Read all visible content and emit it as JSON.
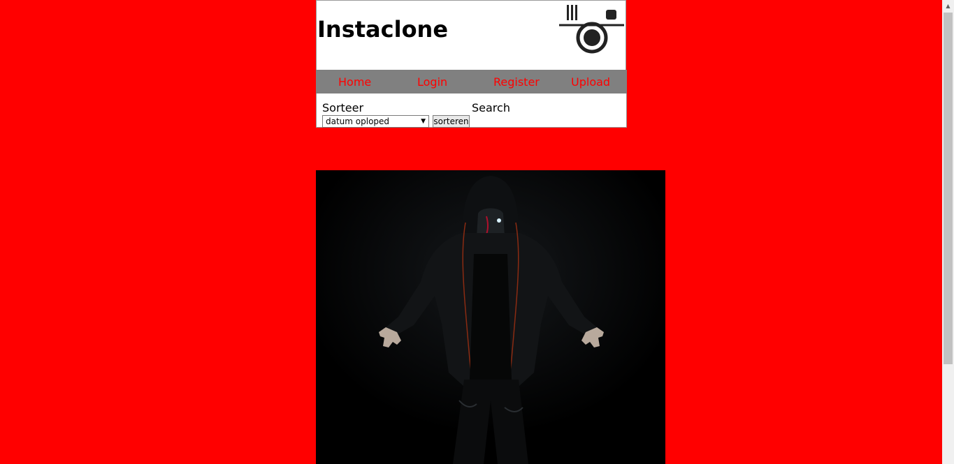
{
  "header": {
    "title": "Instaclone",
    "logo_icon": "camera-icon"
  },
  "nav": {
    "items": [
      {
        "label": "Home"
      },
      {
        "label": "Login"
      },
      {
        "label": "Register"
      },
      {
        "label": "Upload"
      }
    ]
  },
  "controls": {
    "sort_label": "Sorteer",
    "search_label": "Search",
    "sort_selected": "datum oploped",
    "sort_button": "sorteren"
  },
  "photo": {
    "subject": "hooded-figure-image"
  },
  "colors": {
    "background": "#ff0000",
    "nav_background": "#808080",
    "nav_text": "#ff0000"
  }
}
